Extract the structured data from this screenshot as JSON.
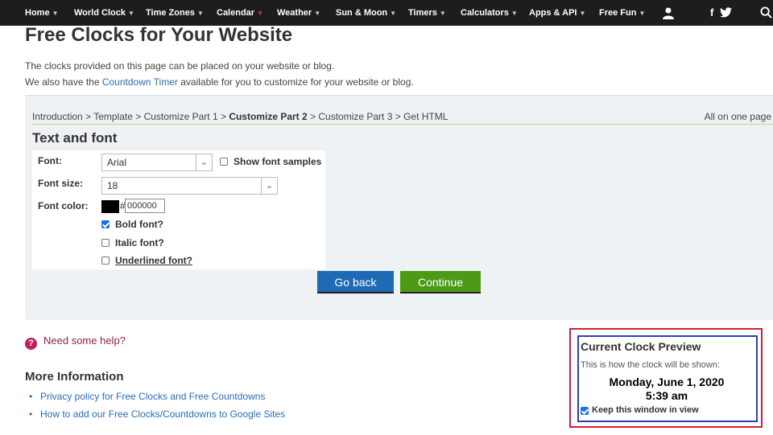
{
  "nav": {
    "items": [
      {
        "label": "Home"
      },
      {
        "label": "World Clock"
      },
      {
        "label": "Time Zones"
      },
      {
        "label": "Calendar"
      },
      {
        "label": "Weather"
      },
      {
        "label": "Sun & Moon"
      },
      {
        "label": "Timers"
      },
      {
        "label": "Calculators"
      },
      {
        "label": "Apps & API"
      },
      {
        "label": "Free Fun"
      }
    ],
    "icons": [
      "user-icon",
      "facebook-icon",
      "twitter-icon",
      "search-icon"
    ]
  },
  "page": {
    "title": "Free Clocks for Your Website",
    "intro1": "The clocks provided on this page can be placed on your website or blog.",
    "intro2_prefix": "We also have the ",
    "intro2_link": "Countdown Timer",
    "intro2_suffix": " available for you to customize for your website or blog."
  },
  "wizard": {
    "breadcrumb": {
      "step1": "Introduction",
      "step2": "Template",
      "step3": "Customize Part 1",
      "current": "Customize Part 2",
      "step5": "Customize Part 3",
      "step6": "Get HTML",
      "sep": " > "
    },
    "all_on_one": "All on one page",
    "section_title": "Text and font",
    "font_label": "Font:",
    "font_value": "Arial",
    "show_samples_label": "Show font samples",
    "show_samples_checked": false,
    "size_label": "Font size:",
    "size_value": "18",
    "color_label": "Font color:",
    "color_hash": "#",
    "color_value": "000000",
    "swatch_color": "#000000",
    "bold_label": "Bold font?",
    "bold_checked": true,
    "italic_label": "Italic font?",
    "italic_checked": false,
    "underline_label": "Underlined font?",
    "underline_checked": false,
    "back_label": "Go back",
    "continue_label": "Continue"
  },
  "help": {
    "label": "Need some help?"
  },
  "more": {
    "title": "More Information",
    "links": [
      "Privacy policy for Free Clocks and Free Countdowns",
      "How to add our Free Clocks/Countdowns to Google Sites"
    ]
  },
  "preview": {
    "title": "Current Clock Preview",
    "subtitle": "This is how the clock will be shown:",
    "date": "Monday, June 1, 2020",
    "time": "5:39 am",
    "keep_label": "Keep this window in view",
    "keep_checked": true
  },
  "colors": {
    "nav_bg": "#1d1d1d",
    "panel_bg": "#eef2f5",
    "back_btn": "#1f6ab4",
    "continue_btn": "#4c9a16",
    "preview_outer": "#d21e3c",
    "preview_inner": "#2b3fb8"
  }
}
